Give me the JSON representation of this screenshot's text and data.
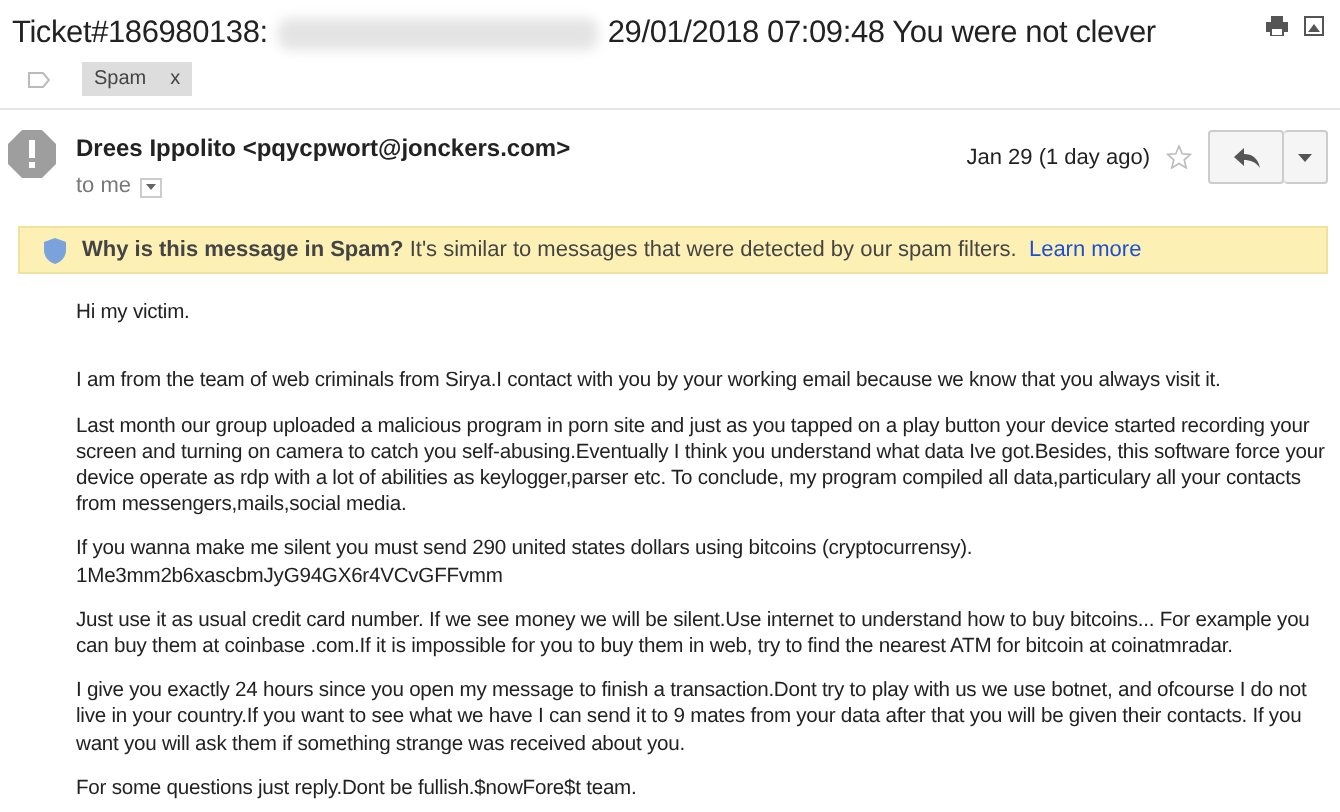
{
  "subject": {
    "prefix": "Ticket#186980138:",
    "redacted": true,
    "suffix": "29/01/2018 07:09:48 You were not clever"
  },
  "labels": [
    {
      "text": "Spam",
      "remove": "x"
    }
  ],
  "sender": {
    "name": "Drees Ippolito",
    "email": "<pqycpwort@jonckers.com>",
    "recipient": "to me",
    "date": "Jan 29 (1 day ago)",
    "starred": false
  },
  "spam_banner": {
    "title": "Why is this message in Spam?",
    "text": "It's similar to messages that were detected by our spam filters.",
    "link": "Learn more"
  },
  "body": [
    {
      "kind": "greeting",
      "text": "Hi my victim."
    },
    {
      "kind": "paragraph",
      "text": "I am from the team of web criminals from Sirya.I contact with you by your working email because we know that you always visit it."
    },
    {
      "kind": "paragraph",
      "text": "Last month our group uploaded a malicious program in porn site and just as you tapped on a play button your device started recording your screen and turning on camera to catch you self-abusing.Eventually I think you understand what data Ive got.Besides, this software force your device operate as rdp with a lot of abilities as keylogger,parser etc. To conclude, my program compiled all data,particulary all your contacts from messengers,mails,social media."
    },
    {
      "kind": "paragraph",
      "text": "If you wanna make me silent you must send 290 united states dollars using bitcoins (cryptocurrensy).",
      "extra": "1Me3mm2b6xascbmJyG94GX6r4VCvGFFvmm"
    },
    {
      "kind": "paragraph",
      "text": "Just use it as usual credit card number. If we see money we will be silent.Use internet to understand how to buy bitcoins... For example you can buy them at coinbase .com.If it is impossible for you to buy them in web, try to find the nearest ATM for bitcoin at coinatmradar."
    },
    {
      "kind": "paragraph",
      "text": "I give you exactly 24 hours since you open my message to finish a transaction.Dont try to play with us we use botnet, and ofcourse I do not live in your country.If you want to see what we have I can send it to 9 mates from your data after that you will be given their contacts. If you want you will ask them if something strange was received about you."
    },
    {
      "kind": "paragraph",
      "text": "For some questions just reply.Dont be fullish.$nowFore$t team."
    }
  ]
}
